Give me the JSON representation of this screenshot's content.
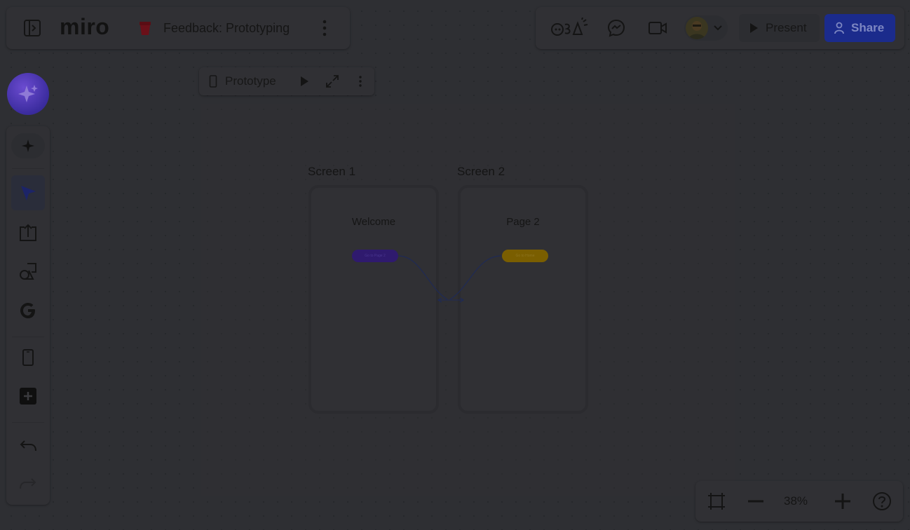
{
  "header": {
    "logo": "miro",
    "board_title": "Feedback: Prototyping"
  },
  "actions": {
    "present_label": "Present",
    "share_label": "Share"
  },
  "prototype": {
    "toolbar_label": "Prototype",
    "screens": [
      {
        "title": "Screen 1",
        "heading": "Welcome",
        "button_label": "Go to Page 2",
        "button_color": "#2f1a6e"
      },
      {
        "title": "Screen 2",
        "heading": "Page 2",
        "button_label": "Go to Home",
        "button_color": "#7a5e00"
      }
    ]
  },
  "zoom": {
    "level": "38%"
  },
  "colors": {
    "canvas": "#2e2f33",
    "share_button": "#1b2b8c",
    "ai_button": "#4a36b0"
  },
  "icons": {
    "sidebar_toggle": "sidebar-toggle-icon",
    "board_emoji": "red-bucket-icon",
    "more": "kebab-icon",
    "reactions": "reactions-icon",
    "comments": "chat-icon",
    "video": "video-icon",
    "avatar": "avatar",
    "chevron": "chevron-down-icon",
    "play": "play-icon",
    "user": "user-icon"
  }
}
